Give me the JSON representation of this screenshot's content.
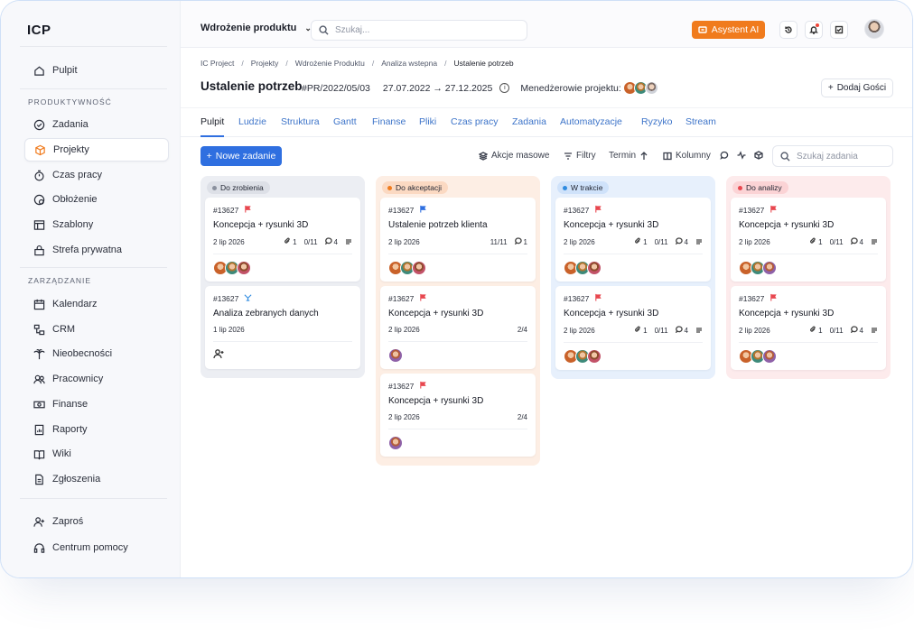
{
  "app": {
    "logo": "ICP"
  },
  "sidebar": {
    "top_items": [
      {
        "label": "Pulpit",
        "icon": "home-icon"
      }
    ],
    "section1_title": "PRODUKTYWNOŚĆ",
    "section1_items": [
      {
        "label": "Zadania",
        "icon": "check-circle-icon"
      },
      {
        "label": "Projekty",
        "icon": "cube-icon",
        "active": true
      },
      {
        "label": "Czas pracy",
        "icon": "stopwatch-icon"
      },
      {
        "label": "Obłożenie",
        "icon": "user-clock-icon"
      },
      {
        "label": "Szablony",
        "icon": "template-icon"
      },
      {
        "label": "Strefa prywatna",
        "icon": "lock-icon"
      }
    ],
    "section2_title": "ZARZĄDZANIE",
    "section2_items": [
      {
        "label": "Kalendarz",
        "icon": "calendar-icon"
      },
      {
        "label": "CRM",
        "icon": "crm-icon"
      },
      {
        "label": "Nieobecności",
        "icon": "palm-tree-icon"
      },
      {
        "label": "Pracownicy",
        "icon": "users-icon"
      },
      {
        "label": "Finanse",
        "icon": "money-icon"
      },
      {
        "label": "Raporty",
        "icon": "report-icon"
      },
      {
        "label": "Wiki",
        "icon": "book-icon"
      },
      {
        "label": "Zgłoszenia",
        "icon": "ticket-icon"
      }
    ],
    "bottom_items": [
      {
        "label": "Zaproś",
        "icon": "user-plus-icon"
      },
      {
        "label": "Centrum pomocy",
        "icon": "headset-icon"
      }
    ]
  },
  "topbar": {
    "project": "Wdrożenie produktu",
    "search_placeholder": "Szukaj...",
    "ai_label": "Asystent AI"
  },
  "breadcrumbs": [
    "IC Project",
    "Projekty",
    "Wdrożenie Produktu",
    "Analiza wstepna",
    "Ustalenie potrzeb"
  ],
  "header": {
    "title": "Ustalenie potrzeb",
    "code": "#PR/2022/05/03",
    "dates": "27.07.2022 → 27.12.2025",
    "managers_label": "Menedżerowie projektu:",
    "add_guests": "Dodaj Gości"
  },
  "tabs": [
    "Pulpit",
    "Ludzie",
    "Struktura",
    "Gantt",
    "Finanse",
    "Pliki",
    "Czas pracy",
    "Zadania",
    "Automatyzacje",
    "Ryzyko",
    "Stream"
  ],
  "toolbar": {
    "new_task": "Nowe zadanie",
    "bulk": "Akcje masowe",
    "filters": "Filtry",
    "term": "Termin",
    "columns": "Kolumny",
    "task_search_placeholder": "Szukaj zadania"
  },
  "columns": [
    {
      "name": "Do zrobienia",
      "bg": "#eceef3",
      "badge_bg": "#dde0e7",
      "dot": "#8a909e",
      "cards": [
        {
          "id": "#13627",
          "flag": "red",
          "title": "Koncepcja + rysunki 3D",
          "date": "2 lip 2026",
          "attachments": "1",
          "checklist": "0/11",
          "comments": "4",
          "desc": true,
          "avatars": [
            "av1",
            "av2",
            "av3"
          ]
        },
        {
          "id": "#13627",
          "flag": "split",
          "title": "Analiza zebranych danych",
          "date": "1 lip 2026",
          "attachments": "",
          "checklist": "",
          "comments": "",
          "desc": false,
          "avatars": [],
          "add_person": true
        }
      ]
    },
    {
      "name": "Do akceptacji",
      "bg": "#fdeee4",
      "badge_bg": "#fbd9c2",
      "dot": "#f07b1d",
      "cards": [
        {
          "id": "#13627",
          "flag": "blue",
          "title": "Ustalenie potrzeb klienta",
          "date": "2 lip 2026",
          "attachments": "",
          "checklist": "11/11",
          "comments": "1",
          "desc": false,
          "avatars": [
            "av1",
            "av2",
            "av3"
          ]
        },
        {
          "id": "#13627",
          "flag": "red",
          "title": "Koncepcja + rysunki 3D",
          "date": "2 lip 2026",
          "attachments": "",
          "checklist": "2/4",
          "comments": "",
          "desc": false,
          "avatars": [
            "av4"
          ]
        },
        {
          "id": "#13627",
          "flag": "red",
          "title": "Koncepcja + rysunki 3D",
          "date": "2 lip 2026",
          "attachments": "",
          "checklist": "2/4",
          "comments": "",
          "desc": false,
          "avatars": [
            "av4"
          ]
        }
      ]
    },
    {
      "name": "W trakcie",
      "bg": "#e7f0fc",
      "badge_bg": "#cfe2fa",
      "dot": "#2f8be0",
      "cards": [
        {
          "id": "#13627",
          "flag": "red",
          "title": "Koncepcja + rysunki 3D",
          "date": "2 lip 2026",
          "attachments": "1",
          "checklist": "0/11",
          "comments": "4",
          "desc": true,
          "avatars": [
            "av1",
            "av2",
            "av3"
          ]
        },
        {
          "id": "#13627",
          "flag": "red",
          "title": "Koncepcja + rysunki 3D",
          "date": "2 lip 2026",
          "attachments": "1",
          "checklist": "0/11",
          "comments": "4",
          "desc": true,
          "avatars": [
            "av1",
            "av2",
            "av3"
          ]
        }
      ]
    },
    {
      "name": "Do analizy",
      "bg": "#fdebec",
      "badge_bg": "#fbd3d5",
      "dot": "#e8474f",
      "cards": [
        {
          "id": "#13627",
          "flag": "red",
          "title": "Koncepcja + rysunki 3D",
          "date": "2 lip 2026",
          "attachments": "1",
          "checklist": "0/11",
          "comments": "4",
          "desc": true,
          "avatars": [
            "av1",
            "av2",
            "av4"
          ]
        },
        {
          "id": "#13627",
          "flag": "red",
          "title": "Koncepcja + rysunki 3D",
          "date": "2 lip 2026",
          "attachments": "1",
          "checklist": "0/11",
          "comments": "4",
          "desc": true,
          "avatars": [
            "av1",
            "av2",
            "av4"
          ]
        }
      ]
    }
  ],
  "colors": {
    "accent": "#2f6fe0",
    "brand_orange": "#f07b1d",
    "flag_red": "#e8474f",
    "flag_blue": "#2f6fe0"
  }
}
